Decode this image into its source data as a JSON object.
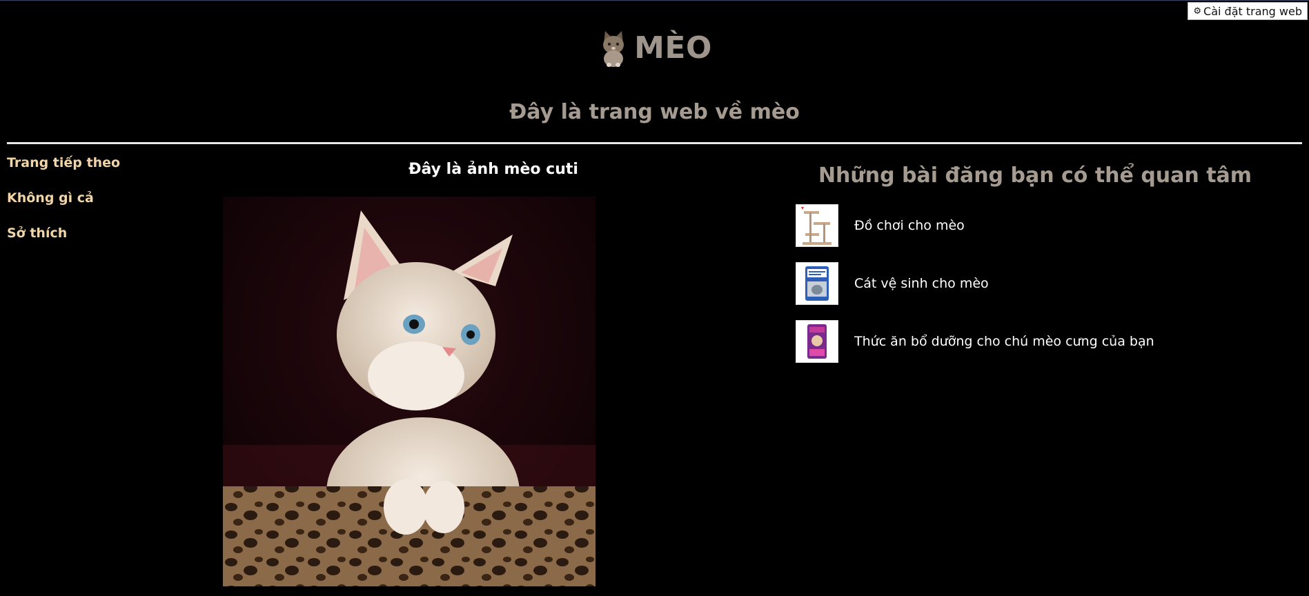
{
  "header": {
    "title": "MÈO",
    "subtitle": "Đây là trang web về mèo"
  },
  "settings": {
    "label": "Cài đặt trang web"
  },
  "nav": {
    "items": [
      {
        "label": "Trang tiếp theo"
      },
      {
        "label": "Không gì cả"
      },
      {
        "label": "Sở thích"
      }
    ]
  },
  "main": {
    "heading": "Đây là ảnh mèo cuti"
  },
  "sidebar": {
    "heading": "Những bài đăng bạn có thể quan tâm",
    "posts": [
      {
        "title": "Đồ chơi cho mèo",
        "icon": "cat-tree-icon"
      },
      {
        "title": "Cát vệ sinh cho mèo",
        "icon": "cat-litter-bag-icon"
      },
      {
        "title": "Thức ăn bổ dưỡng cho chú mèo cưng của bạn",
        "icon": "cat-food-bag-icon"
      }
    ]
  },
  "colors": {
    "background": "#000000",
    "title": "#9e958c",
    "nav_link": "#f1d5a8",
    "text": "#ffffff"
  }
}
